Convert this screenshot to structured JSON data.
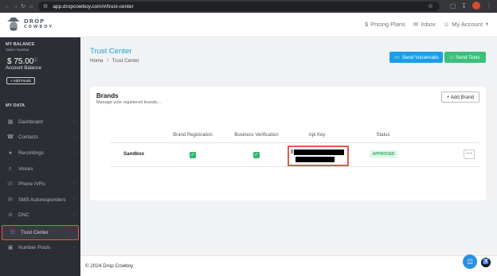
{
  "browser": {
    "url": "app.dropcowboy.com/#/trust-center",
    "icons": [
      "back-icon",
      "forward-icon",
      "reload-icon",
      "home-icon",
      "tune-icon",
      "star-icon",
      "extensions-icon",
      "download-icon",
      "profile-icon"
    ]
  },
  "header": {
    "logo_line1": "DROP",
    "logo_line2": "COWBOY",
    "links": {
      "pricing": "Pricing Plans",
      "inbox": "Inbox",
      "account": "My Account"
    }
  },
  "sidebar": {
    "balance_label": "MY BALANCE",
    "select_number": "Select Number",
    "balance_value": "$ 75.00",
    "balance_label2": "Account Balance",
    "add_funds": "+ Add Funds",
    "section_label": "MY DATA",
    "items": [
      {
        "label": "Dashboard",
        "icon": "chart-icon"
      },
      {
        "label": "Contacts",
        "icon": "contacts-icon"
      },
      {
        "label": "Recordings",
        "icon": "recordings-icon"
      },
      {
        "label": "Voices",
        "icon": "voice-icon"
      },
      {
        "label": "Phone IVRs",
        "icon": "phone-icon"
      },
      {
        "label": "SMS Autoresponders",
        "icon": "sms-icon"
      },
      {
        "label": "DNC",
        "icon": "dnc-icon"
      },
      {
        "label": "Trust Center",
        "icon": "trust-icon"
      },
      {
        "label": "Number Pools",
        "icon": "pool-icon"
      }
    ]
  },
  "main": {
    "title": "Trust Center",
    "breadcrumb": {
      "home": "Home",
      "sep": "/",
      "current": "Trust Center"
    },
    "buttons": {
      "voicemails": "Send Voicemails",
      "texts": "Send Texts"
    },
    "card": {
      "title": "Brands",
      "subtitle": "Manage your registered brands...",
      "add_brand": "+ Add Brand",
      "columns": [
        "Brand Registration",
        "Business Verification",
        "Api Key",
        "Status"
      ],
      "rows": [
        {
          "name": "Sandbox",
          "status": "APPROVED"
        }
      ]
    },
    "footer": "© 2024 Drop Cowboy"
  },
  "colors": {
    "accent": "#1d9fd8",
    "voicemail_btn": "#1a9fe6",
    "texts_btn": "#3bc07a",
    "highlight": "#e05a4c",
    "sidebar": "#2b2e33"
  }
}
